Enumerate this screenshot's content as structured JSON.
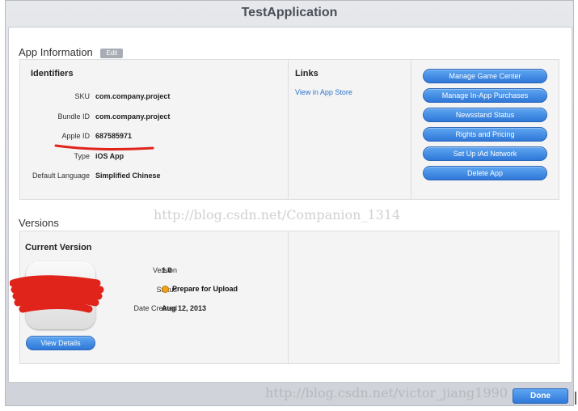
{
  "window": {
    "title": "TestApplication"
  },
  "app_information": {
    "title": "App Information",
    "edit_label": "Edit",
    "identifiers": {
      "heading": "Identifiers",
      "fields": [
        {
          "label": "SKU",
          "value": "com.company.project"
        },
        {
          "label": "Bundle ID",
          "value": "com.company.project"
        },
        {
          "label": "Apple ID",
          "value": "687585971"
        },
        {
          "label": "Type",
          "value": "iOS App"
        },
        {
          "label": "Default Language",
          "value": "Simplified Chinese"
        }
      ]
    },
    "links": {
      "heading": "Links",
      "view_in_store": "View in App Store"
    },
    "actions": [
      "Manage Game Center",
      "Manage In-App Purchases",
      "Newsstand Status",
      "Rights and Pricing",
      "Set Up iAd Network",
      "Delete App"
    ]
  },
  "versions": {
    "title": "Versions",
    "current": {
      "heading": "Current Version",
      "fields": [
        {
          "label": "Version",
          "value": "1.0"
        },
        {
          "label": "Status",
          "value": "Prepare for Upload"
        },
        {
          "label": "Date Created",
          "value": "Aug 12, 2013"
        }
      ],
      "view_details": "View Details"
    }
  },
  "watermarks": {
    "center": "http://blog.csdn.net/Companion_1314",
    "bottom": "http://blog.csdn.net/victor_jiang1990"
  },
  "footer": {
    "done_label": "Done"
  },
  "colors": {
    "accent_blue": "#2f78d8",
    "status_orange": "#f0a21a",
    "annotation_red": "#e0241b"
  }
}
